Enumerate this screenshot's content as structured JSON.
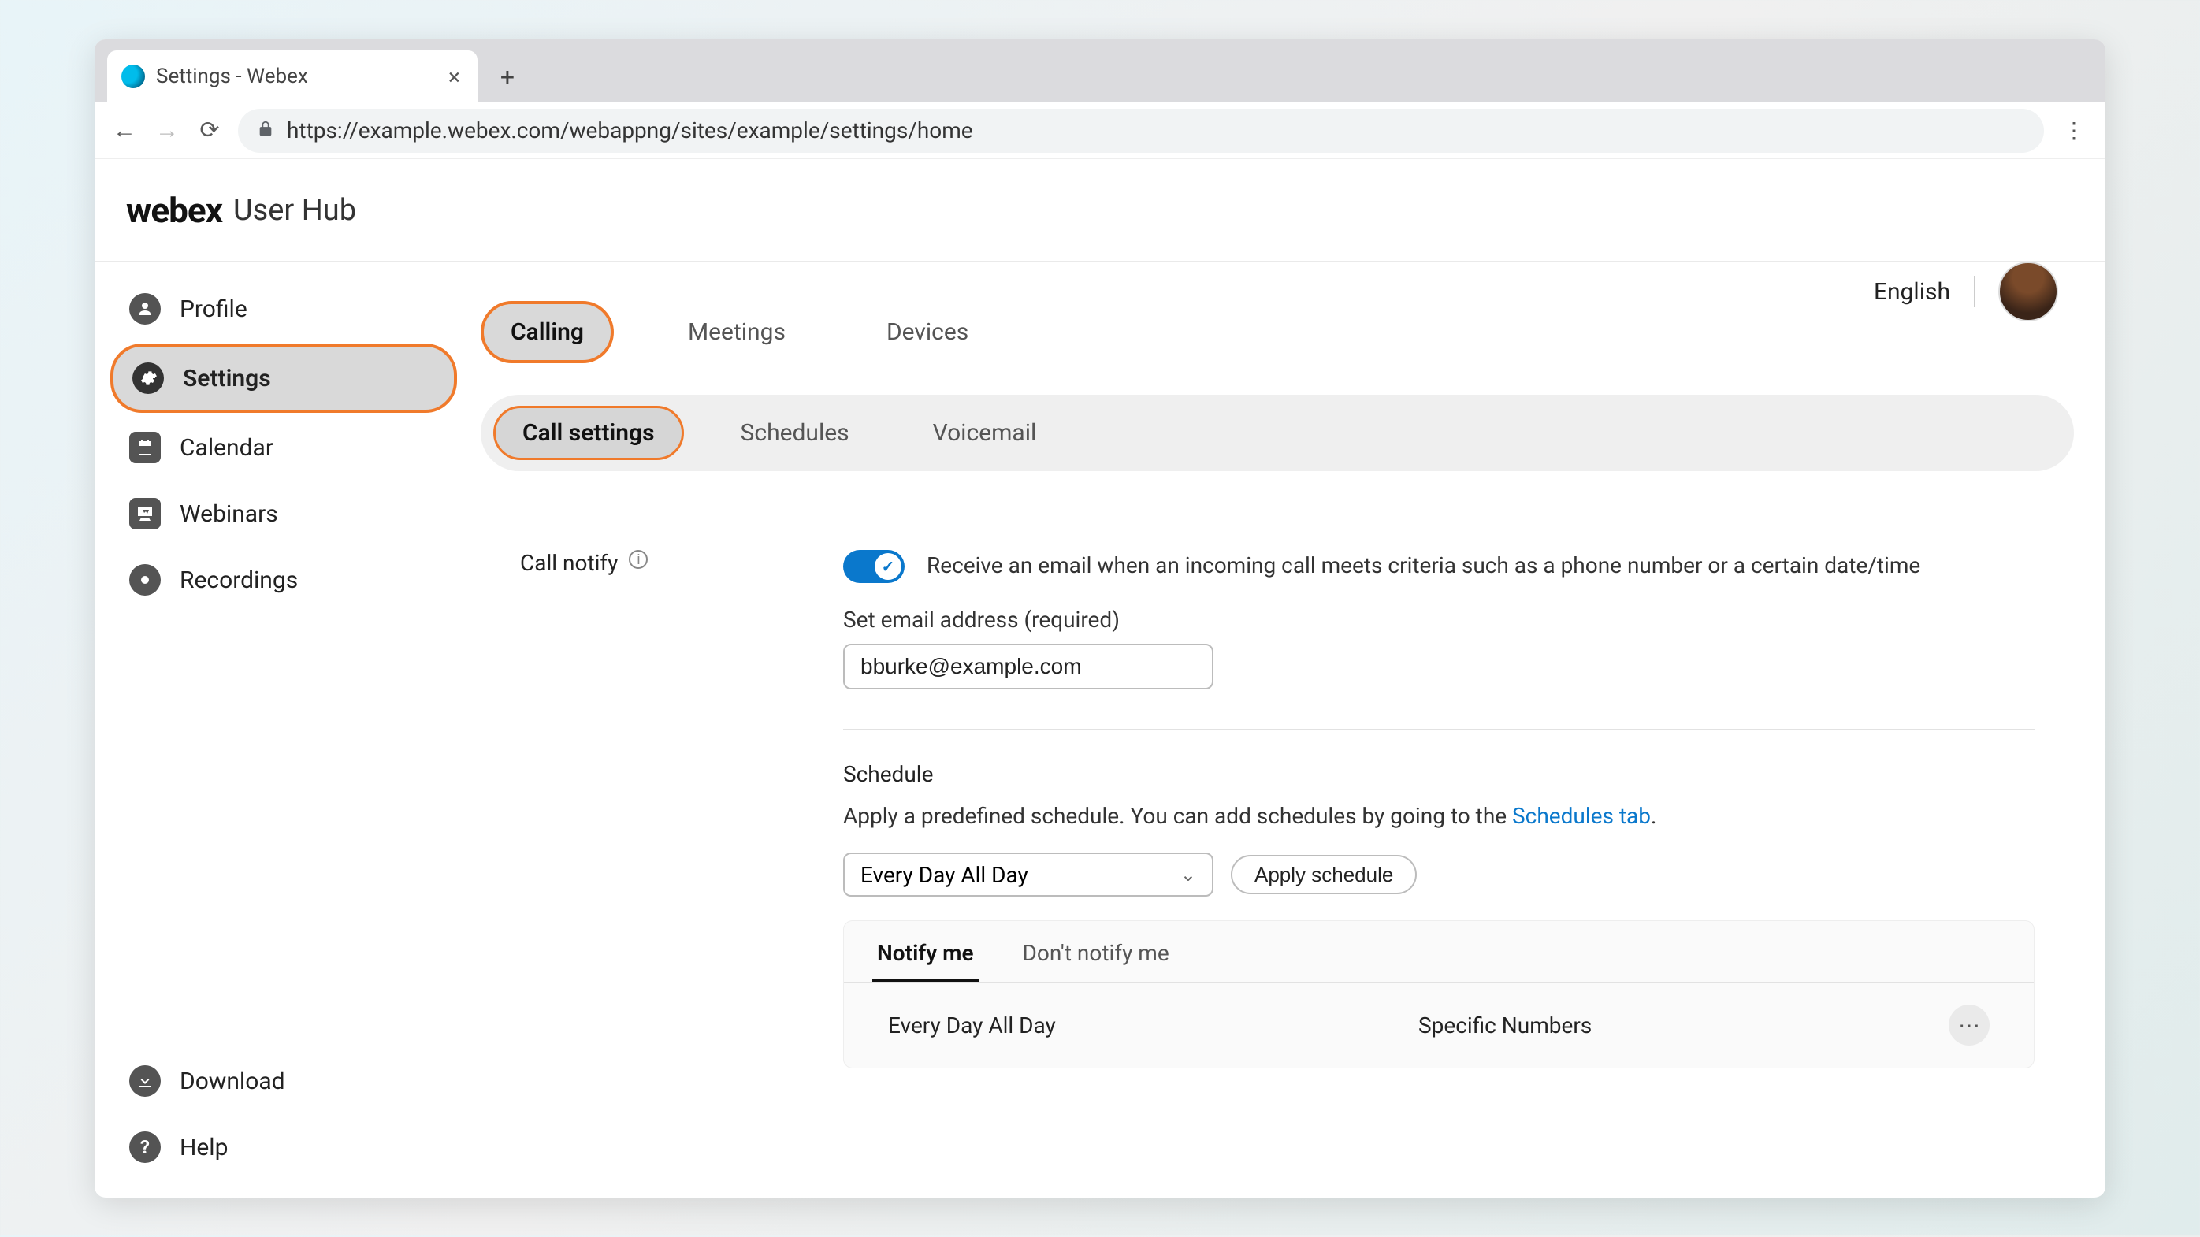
{
  "browser": {
    "tab_title": "Settings - Webex",
    "url": "https://example.webex.com/webappng/sites/example/settings/home"
  },
  "header": {
    "logo": "webex",
    "sub": "User Hub"
  },
  "topright": {
    "language": "English"
  },
  "sidebar": {
    "items": [
      {
        "label": "Profile"
      },
      {
        "label": "Settings"
      },
      {
        "label": "Calendar"
      },
      {
        "label": "Webinars"
      },
      {
        "label": "Recordings"
      }
    ],
    "bottom": [
      {
        "label": "Download"
      },
      {
        "label": "Help"
      }
    ]
  },
  "seg_tabs": {
    "calling": "Calling",
    "meetings": "Meetings",
    "devices": "Devices"
  },
  "subnav": {
    "call_settings": "Call settings",
    "schedules": "Schedules",
    "voicemail": "Voicemail"
  },
  "card": {
    "left_label": "Call notify",
    "description": "Receive an email when an incoming call meets criteria such as a phone number or a certain date/time",
    "email_label": "Set email address (required)",
    "email_value": "bburke@example.com",
    "schedule_title": "Schedule",
    "schedule_desc_prefix": "Apply a predefined schedule. You can add schedules by going to the ",
    "schedule_link": "Schedules tab",
    "schedule_desc_suffix": ".",
    "schedule_select": "Every Day All Day",
    "apply_btn": "Apply schedule",
    "ntabs": {
      "notify": "Notify me",
      "dont": "Don't notify me"
    },
    "nrow": {
      "col1": "Every Day All Day",
      "col2": "Specific Numbers"
    }
  }
}
